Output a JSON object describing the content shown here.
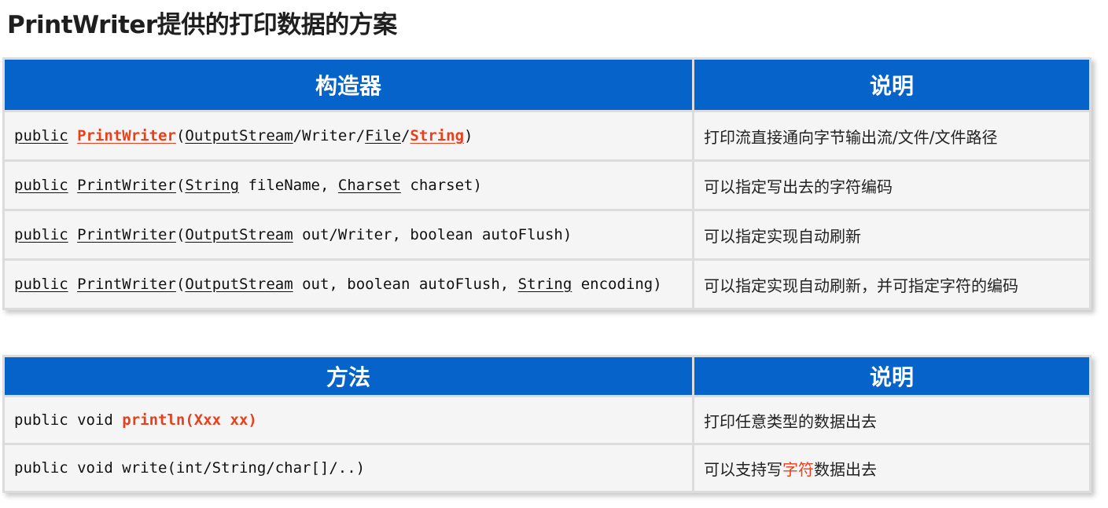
{
  "title": "PrintWriter提供的打印数据的方案",
  "constructors_table": {
    "headers": [
      "构造器",
      "说明"
    ],
    "rows": [
      {
        "code_parts": [
          {
            "text": "public",
            "style": "u"
          },
          {
            "text": " ",
            "style": ""
          },
          {
            "text": "PrintWriter",
            "style": "u hl"
          },
          {
            "text": "(",
            "style": ""
          },
          {
            "text": "OutputStream",
            "style": "u"
          },
          {
            "text": "/Writer/",
            "style": ""
          },
          {
            "text": "File",
            "style": "u"
          },
          {
            "text": "/",
            "style": ""
          },
          {
            "text": "String",
            "style": "u hl"
          },
          {
            "text": ")",
            "style": ""
          }
        ],
        "desc": "打印流直接通向字节输出流/文件/文件路径"
      },
      {
        "code_parts": [
          {
            "text": "public",
            "style": "u"
          },
          {
            "text": " ",
            "style": ""
          },
          {
            "text": "PrintWriter",
            "style": "u"
          },
          {
            "text": "(",
            "style": ""
          },
          {
            "text": "String",
            "style": "u"
          },
          {
            "text": " fileName, ",
            "style": ""
          },
          {
            "text": "Charset",
            "style": "u"
          },
          {
            "text": " charset)",
            "style": ""
          }
        ],
        "desc": "可以指定写出去的字符编码"
      },
      {
        "code_parts": [
          {
            "text": "public",
            "style": "u"
          },
          {
            "text": " ",
            "style": ""
          },
          {
            "text": "PrintWriter",
            "style": "u"
          },
          {
            "text": "(",
            "style": ""
          },
          {
            "text": "OutputStream",
            "style": "u"
          },
          {
            "text": " out/Writer, boolean autoFlush)",
            "style": ""
          }
        ],
        "desc": "可以指定实现自动刷新"
      },
      {
        "code_parts": [
          {
            "text": "public",
            "style": "u"
          },
          {
            "text": " ",
            "style": ""
          },
          {
            "text": "PrintWriter",
            "style": "u"
          },
          {
            "text": "(",
            "style": ""
          },
          {
            "text": "OutputStream",
            "style": "u"
          },
          {
            "text": " out, boolean autoFlush, ",
            "style": ""
          },
          {
            "text": "String",
            "style": "u"
          },
          {
            "text": " encoding)",
            "style": ""
          }
        ],
        "desc": "可以指定实现自动刷新，并可指定字符的编码"
      }
    ]
  },
  "methods_table": {
    "headers": [
      "方法",
      "说明"
    ],
    "rows": [
      {
        "code_parts": [
          {
            "text": "public void ",
            "style": ""
          },
          {
            "text": "println(Xxx xx)",
            "style": "hl"
          }
        ],
        "desc_parts": [
          {
            "text": "打印任意类型的数据出去",
            "style": ""
          }
        ]
      },
      {
        "code_parts": [
          {
            "text": "public void write(int/String/char[]/..)",
            "style": ""
          }
        ],
        "desc_parts": [
          {
            "text": "可以支持写",
            "style": ""
          },
          {
            "text": "字符",
            "style": "hl-plain"
          },
          {
            "text": "数据出去",
            "style": ""
          }
        ]
      }
    ]
  },
  "colors": {
    "header_bg": "#0563c9",
    "header_text": "#ffffff",
    "highlight": "#e8401c",
    "cell_bg": "#f5f5f5"
  }
}
